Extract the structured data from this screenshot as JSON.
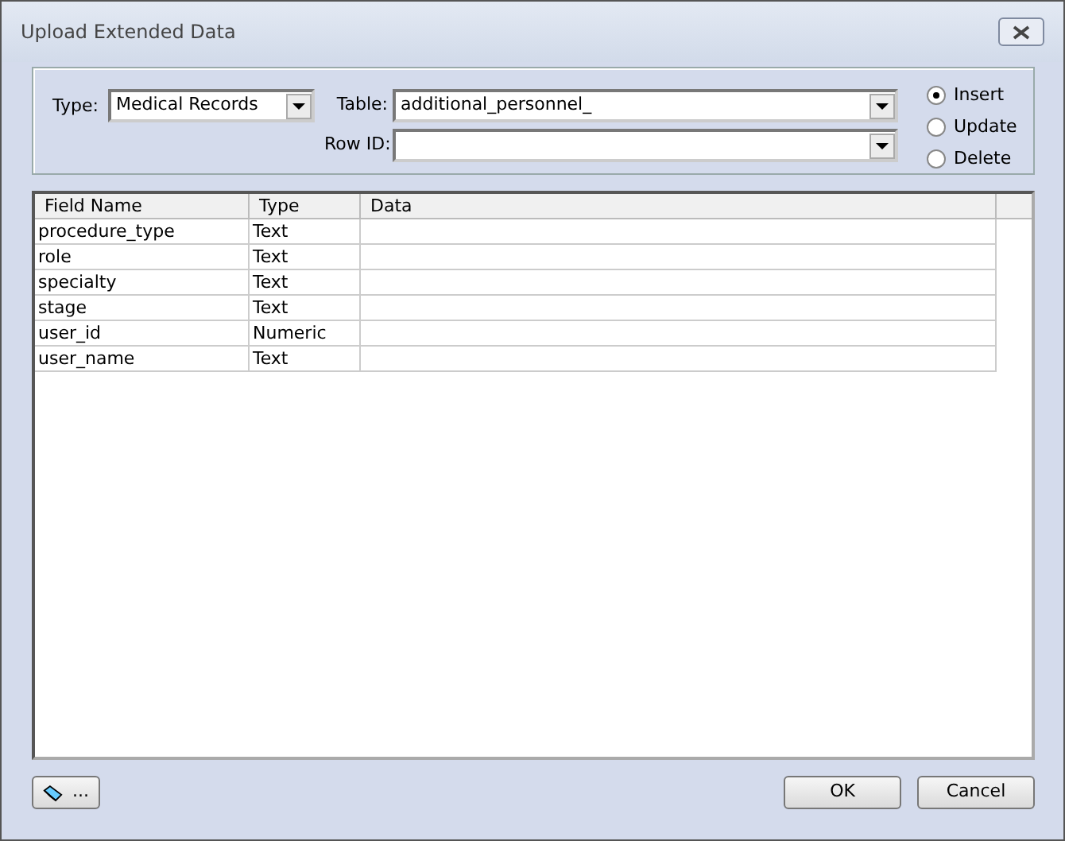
{
  "window": {
    "title": "Upload Extended Data"
  },
  "type_field": {
    "label": "Type:",
    "value": "Medical Records"
  },
  "table_field": {
    "label": "Table:",
    "value": "additional_personnel_"
  },
  "row_id_field": {
    "label": "Row ID:"
  },
  "modes": [
    {
      "label": "Insert",
      "selected": true
    },
    {
      "label": "Update",
      "selected": false
    },
    {
      "label": "Delete",
      "selected": false
    }
  ],
  "grid": {
    "columns": [
      "Field Name",
      "Type",
      "Data"
    ],
    "rows": [
      {
        "field_name": "procedure_type",
        "type": "Text"
      },
      {
        "field_name": "role",
        "type": "Text"
      },
      {
        "field_name": "specialty",
        "type": "Text"
      },
      {
        "field_name": "stage",
        "type": "Text"
      },
      {
        "field_name": "user_id",
        "type": "Numeric"
      },
      {
        "field_name": "user_name",
        "type": "Text"
      }
    ]
  },
  "footer": {
    "tool_button": "...",
    "ok": "OK",
    "cancel": "Cancel"
  }
}
